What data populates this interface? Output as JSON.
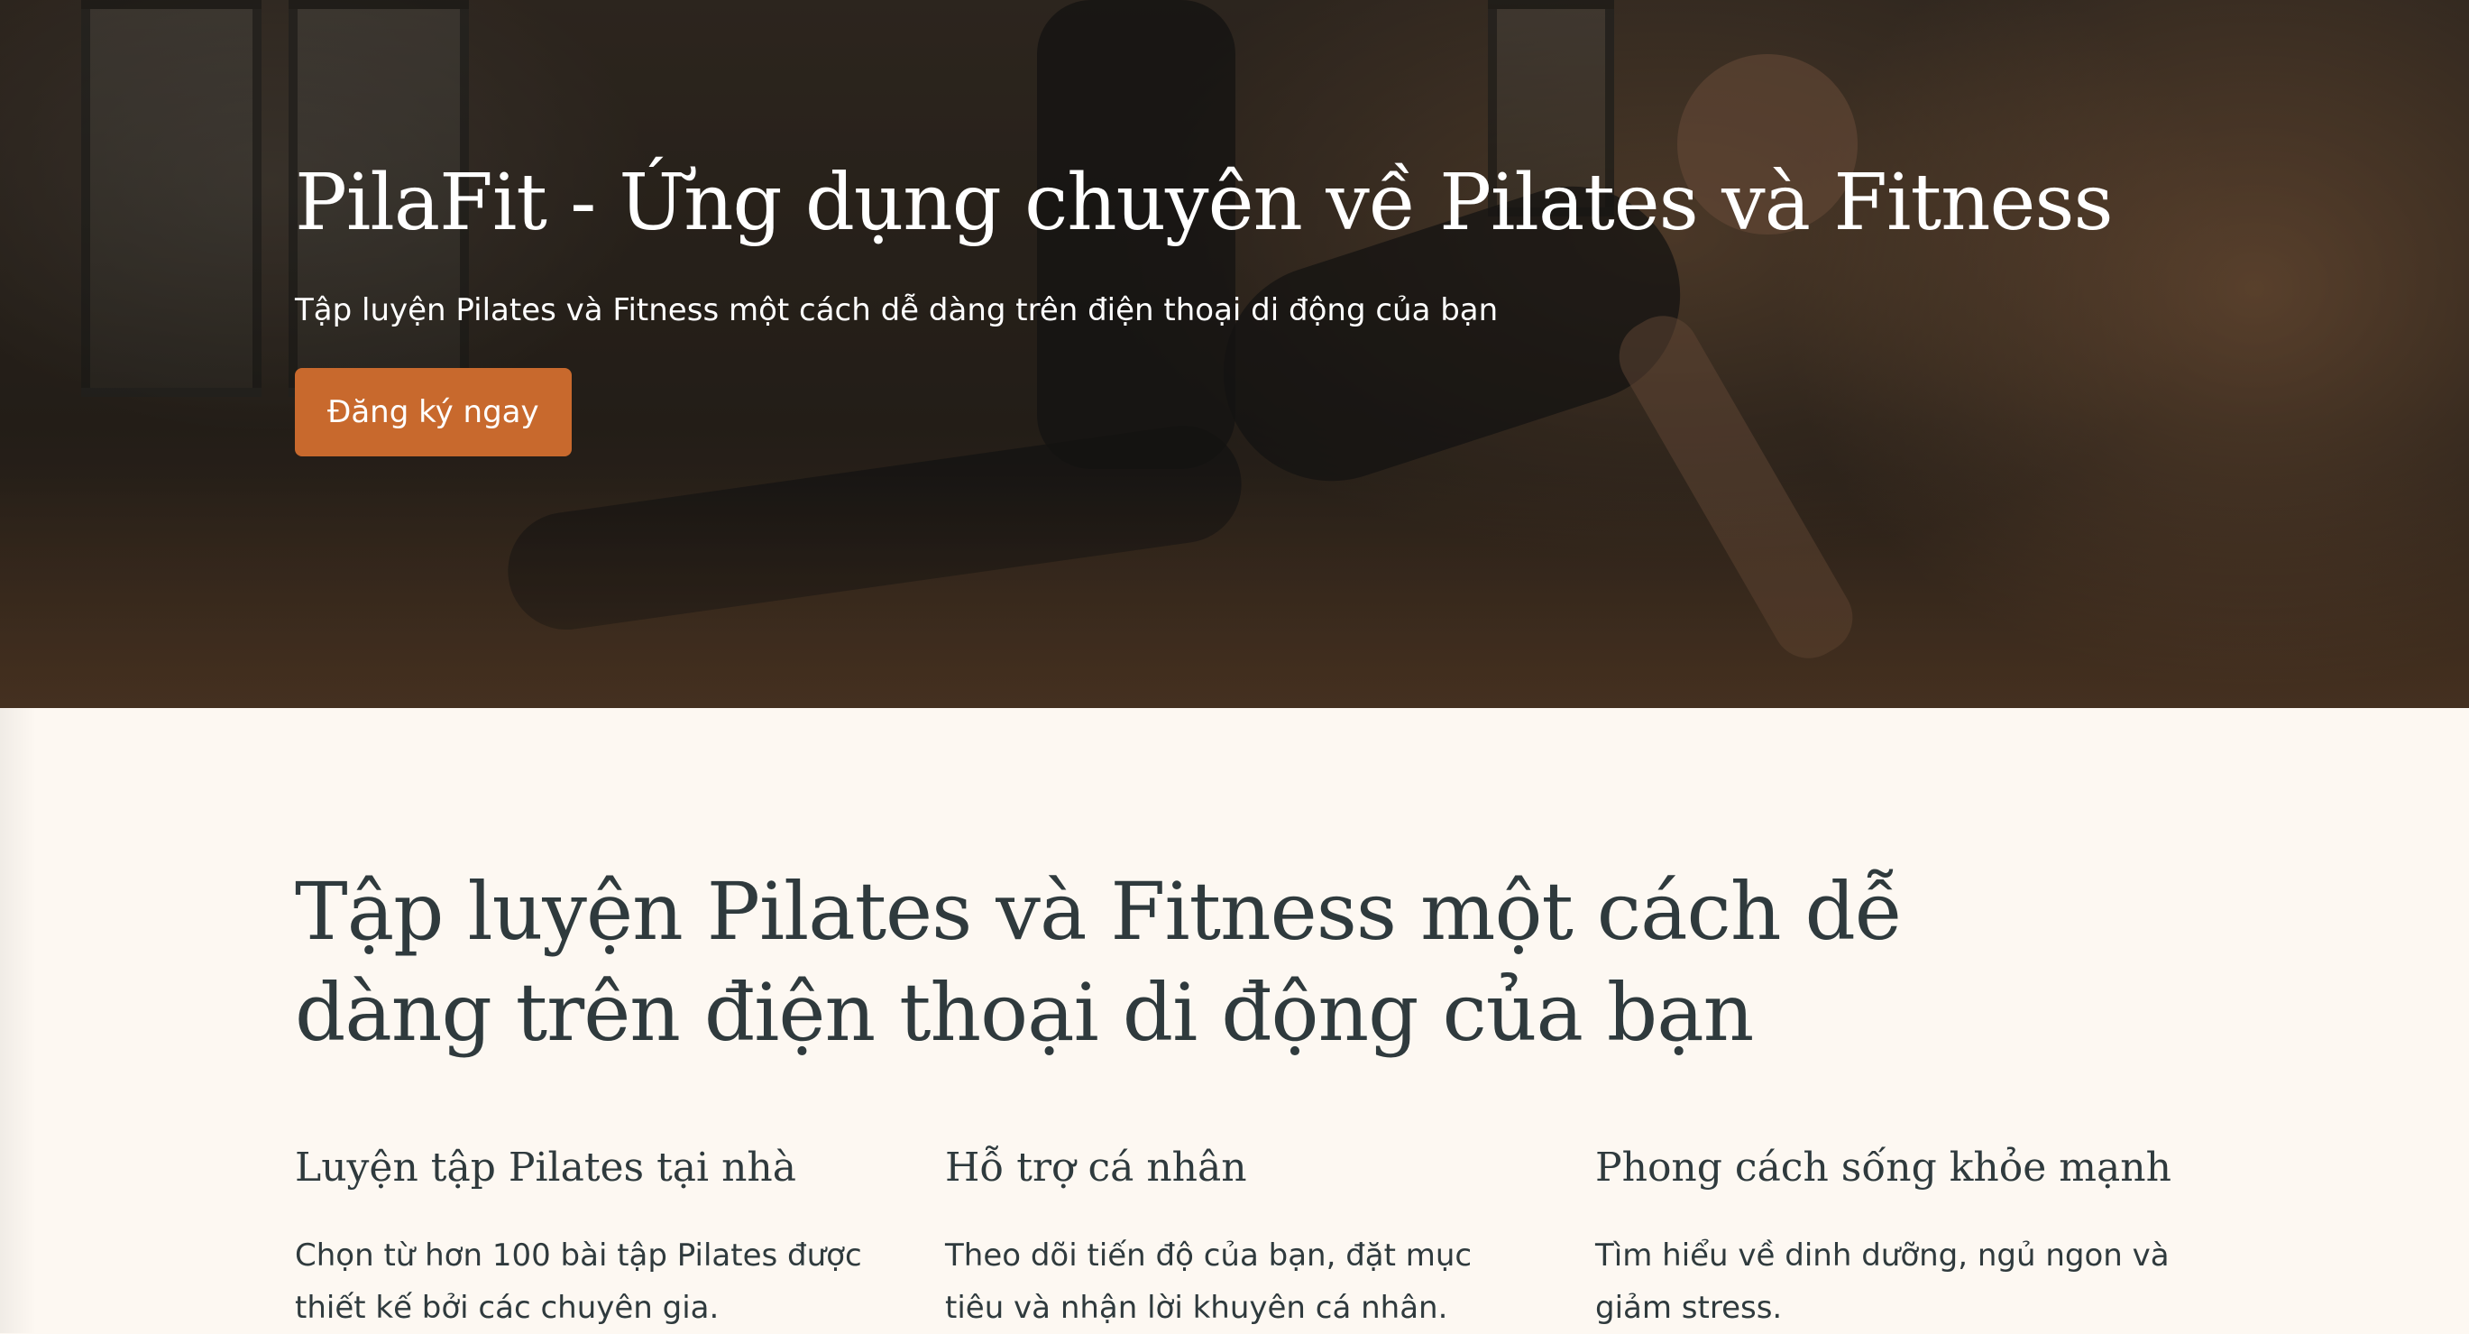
{
  "hero": {
    "title": "PilaFit - Ứng dụng chuyên về Pilates và Fitness",
    "subtitle": "Tập luyện Pilates và Fitness một cách dễ dàng trên điện thoại di động của bạn",
    "cta_label": "Đăng ký ngay",
    "cta_color": "#c8692d"
  },
  "features": {
    "heading": "Tập luyện Pilates và Fitness một cách dễ dàng trên điện thoại di động của bạn",
    "items": [
      {
        "title": "Luyện tập Pilates tại nhà",
        "text": "Chọn từ hơn 100 bài tập Pilates được thiết kế bởi các chuyên gia."
      },
      {
        "title": "Hỗ trợ cá nhân",
        "text": "Theo dõi tiến độ của bạn, đặt mục tiêu và nhận lời khuyên cá nhân."
      },
      {
        "title": "Phong cách sống khỏe mạnh",
        "text": "Tìm hiểu về dinh dưỡng, ngủ ngon và giảm stress."
      }
    ]
  },
  "colors": {
    "background": "#fdf8f2",
    "heading_text": "#2f3a3d",
    "accent": "#c8692d"
  }
}
